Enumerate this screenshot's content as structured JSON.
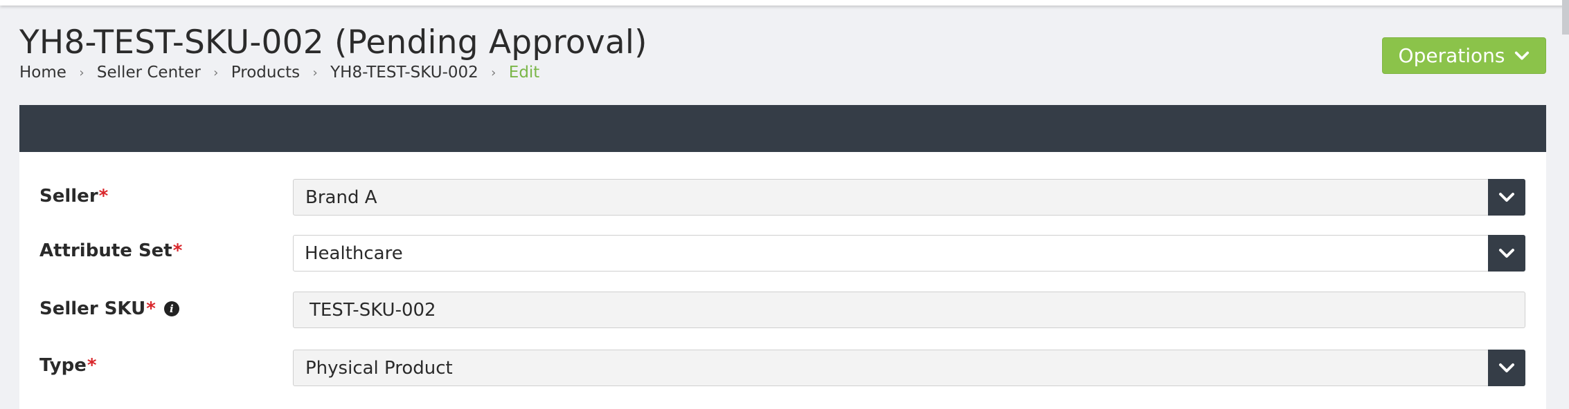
{
  "page": {
    "title": "YH8-TEST-SKU-002 (Pending Approval)"
  },
  "breadcrumb": {
    "items": [
      "Home",
      "Seller Center",
      "Products",
      "YH8-TEST-SKU-002"
    ],
    "current": "Edit"
  },
  "operations_button": {
    "label": "Operations",
    "icon": "chevron-down-icon"
  },
  "form": {
    "required_marker": "*",
    "seller": {
      "label": "Seller",
      "value": "Brand A"
    },
    "attribute_set": {
      "label": "Attribute Set",
      "value": "Healthcare"
    },
    "seller_sku": {
      "label": "Seller SKU",
      "value": "TEST-SKU-002",
      "info_icon": "info-icon"
    },
    "type": {
      "label": "Type",
      "value": "Physical Product"
    }
  },
  "colors": {
    "accent_green": "#8bc34a",
    "breadcrumb_current": "#7ab648",
    "dark_header": "#353d47",
    "required": "#d9262b"
  }
}
